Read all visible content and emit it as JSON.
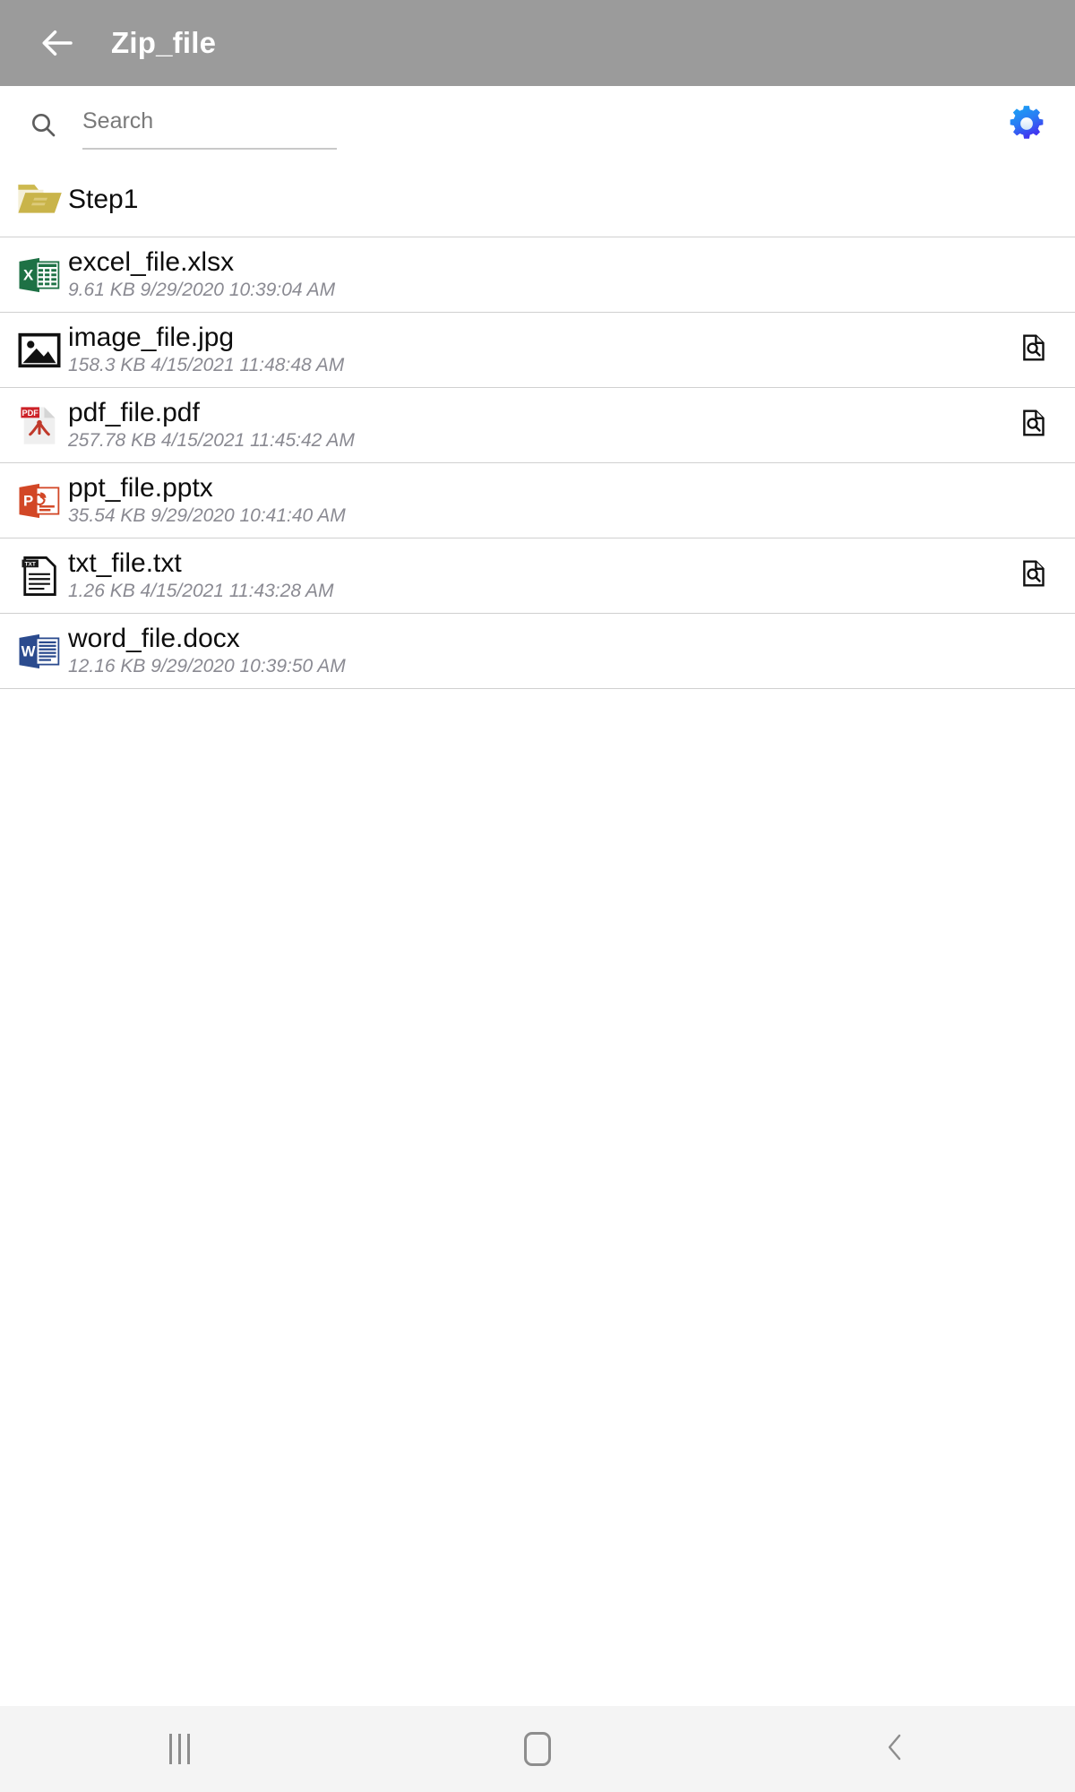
{
  "appbar": {
    "back_icon": "arrow-left-icon",
    "title": "Zip_file"
  },
  "search": {
    "icon": "search-icon",
    "placeholder": "Search",
    "value": "",
    "settings_icon": "gear-icon",
    "settings_color": "#2a7cf4"
  },
  "list": {
    "items": [
      {
        "name": "Step1",
        "meta": "",
        "icon": "folder-icon",
        "type": "folder",
        "has_preview": false
      },
      {
        "name": "excel_file.xlsx",
        "meta": "9.61 KB  9/29/2020 10:39:04 AM",
        "icon": "excel-file-icon",
        "type": "xlsx",
        "has_preview": false
      },
      {
        "name": "image_file.jpg",
        "meta": "158.3 KB  4/15/2021 11:48:48 AM",
        "icon": "image-file-icon",
        "type": "jpg",
        "has_preview": true
      },
      {
        "name": "pdf_file.pdf",
        "meta": "257.78 KB  4/15/2021 11:45:42 AM",
        "icon": "pdf-file-icon",
        "type": "pdf",
        "has_preview": true
      },
      {
        "name": "ppt_file.pptx",
        "meta": "35.54 KB  9/29/2020 10:41:40 AM",
        "icon": "powerpoint-file-icon",
        "type": "pptx",
        "has_preview": false
      },
      {
        "name": "txt_file.txt",
        "meta": "1.26 KB  4/15/2021 11:43:28 AM",
        "icon": "text-file-icon",
        "type": "txt",
        "has_preview": true
      },
      {
        "name": "word_file.docx",
        "meta": "12.16 KB  9/29/2020 10:39:50 AM",
        "icon": "word-file-icon",
        "type": "docx",
        "has_preview": false
      }
    ],
    "preview_icon": "document-search-icon"
  },
  "navbar": {
    "recents_icon": "recents-icon",
    "home_icon": "home-icon",
    "back_icon": "back-chevron-icon"
  },
  "colors": {
    "appbar_bg": "#9b9b9b",
    "excel_green": "#1e7145",
    "word_blue": "#2b4b8e",
    "ppt_orange": "#d24726",
    "pdf_red": "#cc2127",
    "folder_olive": "#c3ae4b",
    "meta_gray": "#8a8a92"
  }
}
